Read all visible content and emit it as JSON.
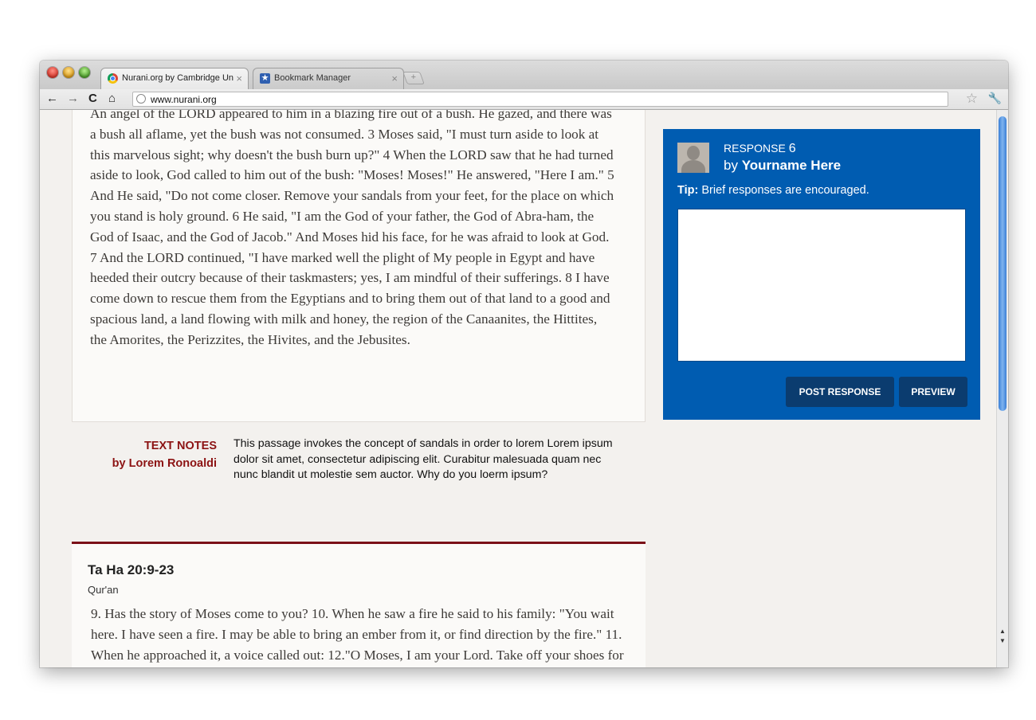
{
  "browser": {
    "tabs": [
      {
        "title": "Nurani.org  by Cambridge Un",
        "active": true,
        "icon": "chrome-icon"
      },
      {
        "title": "Bookmark Manager",
        "active": false,
        "icon": "bookmark-star-icon"
      }
    ],
    "close_glyph": "×",
    "new_tab_glyph": "+",
    "url": "www.nurani.org"
  },
  "passage": {
    "text": "An angel of the LORD appeared to him in a blazing fire out of a bush. He gazed, and there was a bush all aflame, yet the bush was not consumed.  3 Moses said, \"I must turn aside to look at this marvelous sight; why doesn't the bush burn up?\"  4 When the LORD saw that he had turned aside to look, God called to him out of the bush: \"Moses! Moses!\" He answered, \"Here I am.\"  5 And He said, \"Do not come closer. Remove your sandals from your feet, for the place on which you stand is holy ground.  6 He said, \"I am the God of your father, the God of Abra-ham, the God of Isaac, and the God of Jacob.\" And Moses hid his face, for he was afraid to look at God.  7 And the LORD continued, \"I have marked well the plight of My people in Egypt and have heeded their outcry because of their taskmasters; yes, I am mindful of their sufferings.  8 I have come down to rescue them from the Egyptians and to bring them out of that land to a good and spacious land, a land flowing with milk and honey, the region of the Canaanites, the Hittites, the Amorites, the Perizzites, the Hivites, and the Jebusites."
  },
  "notes": {
    "title": "TEXT NOTES",
    "author": "by Lorem Ronoaldi",
    "body": "This passage invokes the concept of sandals in order to lorem Lorem ipsum dolor sit amet, consectetur adipiscing elit. Curabitur malesuada quam nec nunc blandit ut molestie sem auctor. Why do you loerm ipsum?"
  },
  "second_passage": {
    "reference": "Ta Ha 20:9-23",
    "source": "Qur'an",
    "text": "9. Has the story of Moses come to you? 10. When he saw a fire he said to his family: \"You wait here. I have seen a fire. I may be able to bring an ember from it, or find direction by the fire.\" 11. When he approached it, a voice called out:  12.\"O Moses, I am your Lord. Take off your shoes for you are in the sacred valley of Tuwa."
  },
  "response": {
    "label": "RESPONSE",
    "number": "6",
    "by": "by",
    "author": "Yourname Here",
    "tip_label": "Tip:",
    "tip_text": "Brief responses are encouraged.",
    "value": "",
    "post_label": "POST RESPONSE",
    "preview_label": "PREVIEW",
    "panel_color": "#005cb1"
  }
}
